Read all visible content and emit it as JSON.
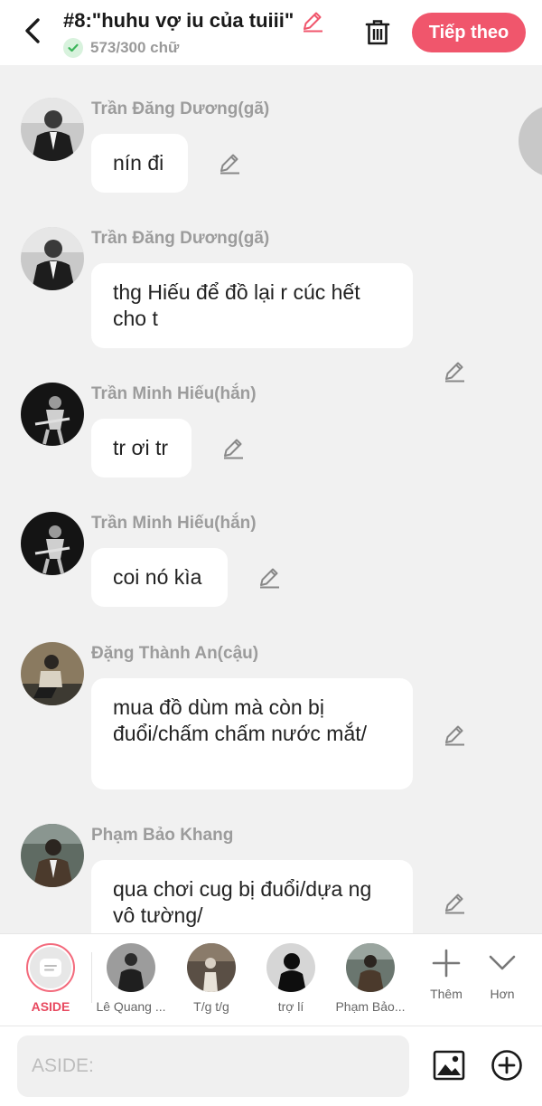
{
  "header": {
    "title": "#8:\"huhu vợ iu của tuiii\"",
    "word_count": "573/300 chữ",
    "next_label": "Tiếp theo"
  },
  "messages": [
    {
      "author": "Trần Đăng Dương(gã)",
      "text": "nín đi",
      "avatar_icon": "avatar-man-suit"
    },
    {
      "author": "Trần Đăng Dương(gã)",
      "text": "thg Hiếu để đồ lại r cúc hết cho t",
      "avatar_icon": "avatar-man-suit"
    },
    {
      "author": "Trần Minh Hiếu(hắn)",
      "text": "tr ơi tr",
      "avatar_icon": "avatar-guitarist"
    },
    {
      "author": "Trần Minh Hiếu(hắn)",
      "text": "coi nó kìa",
      "avatar_icon": "avatar-guitarist"
    },
    {
      "author": "Đặng Thành An(cậu)",
      "text": "mua đồ dùm mà còn bị đuổi/chấm chấm nước mắt/",
      "avatar_icon": "avatar-sitting-man"
    },
    {
      "author": "Phạm Bảo Khang",
      "text": "qua chơi cug bị đuổi/dựa ng vô tường/",
      "avatar_icon": "avatar-man-jacket"
    }
  ],
  "characters": [
    {
      "label": "ASIDE",
      "selected": true
    },
    {
      "label": "Lê Quang ..."
    },
    {
      "label": "T/g t/g"
    },
    {
      "label": "trợ lí"
    },
    {
      "label": "Phạm Bảo..."
    }
  ],
  "tools": [
    {
      "label": "Thêm",
      "icon": "plus-icon"
    },
    {
      "label": "Hơn",
      "icon": "chevron-down-icon"
    }
  ],
  "input": {
    "placeholder": "ASIDE:"
  },
  "colors": {
    "accent": "#f0566c",
    "aside": "#e8495f",
    "background": "#f1f1f1",
    "bubble": "#ffffff"
  }
}
